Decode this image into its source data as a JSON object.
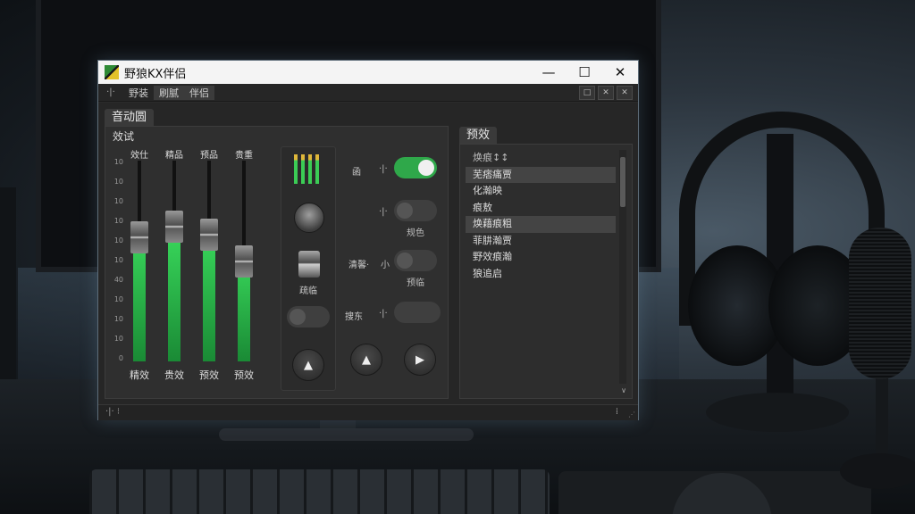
{
  "window": {
    "title": "野狼KX伴侣",
    "minimize": "—",
    "maximize": "☐",
    "close": "✕"
  },
  "menu": {
    "icon": "·|·",
    "items": [
      "野装",
      "刷腻",
      "伴侣"
    ],
    "inner_controls": [
      "□",
      "✕",
      "✕"
    ]
  },
  "main_tab": {
    "label": "音动圆",
    "sub": "效试"
  },
  "mixer": {
    "scale": [
      "10",
      "10",
      "10",
      "10",
      "10",
      "10",
      "40",
      "10",
      "10",
      "10",
      "0"
    ],
    "channels": [
      {
        "header": "效仕",
        "footer": "精效",
        "level": 0.62,
        "fader": 0.38
      },
      {
        "header": "精品",
        "footer": "贵效",
        "level": 0.63,
        "fader": 0.33
      },
      {
        "header": "预品",
        "footer": "预效",
        "level": 0.63,
        "fader": 0.37
      },
      {
        "header": "贵重",
        "footer": "预效",
        "level": 0.52,
        "fader": 0.5
      }
    ]
  },
  "mid": {
    "fader_label": "疏临",
    "up_button": "▲"
  },
  "controls": {
    "row1": {
      "label": "函",
      "icon": "·|·",
      "on": true
    },
    "row2": {
      "icon": "·|·",
      "caption": "规色",
      "on": false
    },
    "row3": {
      "label": "清馨·",
      "icon": "小",
      "caption": "预临",
      "on": false
    },
    "row4": {
      "label": "搜东",
      "icon": "·|·",
      "on": false
    },
    "buttons": [
      "▲",
      "▶"
    ],
    "eject_caption": "|/\\|"
  },
  "presets": {
    "tab": "预效",
    "items": [
      {
        "label": "焕痕↕↕",
        "head": true,
        "selected": false
      },
      {
        "label": "芜痞痛贾",
        "selected": true
      },
      {
        "label": "化瀚映",
        "selected": false
      },
      {
        "label": "痕敖",
        "selected": false
      },
      {
        "label": "焕藉痕粗",
        "selected": true
      },
      {
        "label": "菲肼瀚贾",
        "selected": false
      },
      {
        "label": "野效痕瀚",
        "selected": false
      },
      {
        "label": "狼追启",
        "selected": false
      }
    ],
    "scroll_down": "∨"
  },
  "status": {
    "left": "·|·  ⁝",
    "right": "⁞"
  },
  "colors": {
    "accent_green": "#2fa84a",
    "meter_green": "#38d65a",
    "window_bg": "#2a2a2a"
  },
  "icons": [
    "app-icon",
    "audio-icon",
    "play-icon",
    "eject-icon",
    "up-arrow-icon"
  ]
}
